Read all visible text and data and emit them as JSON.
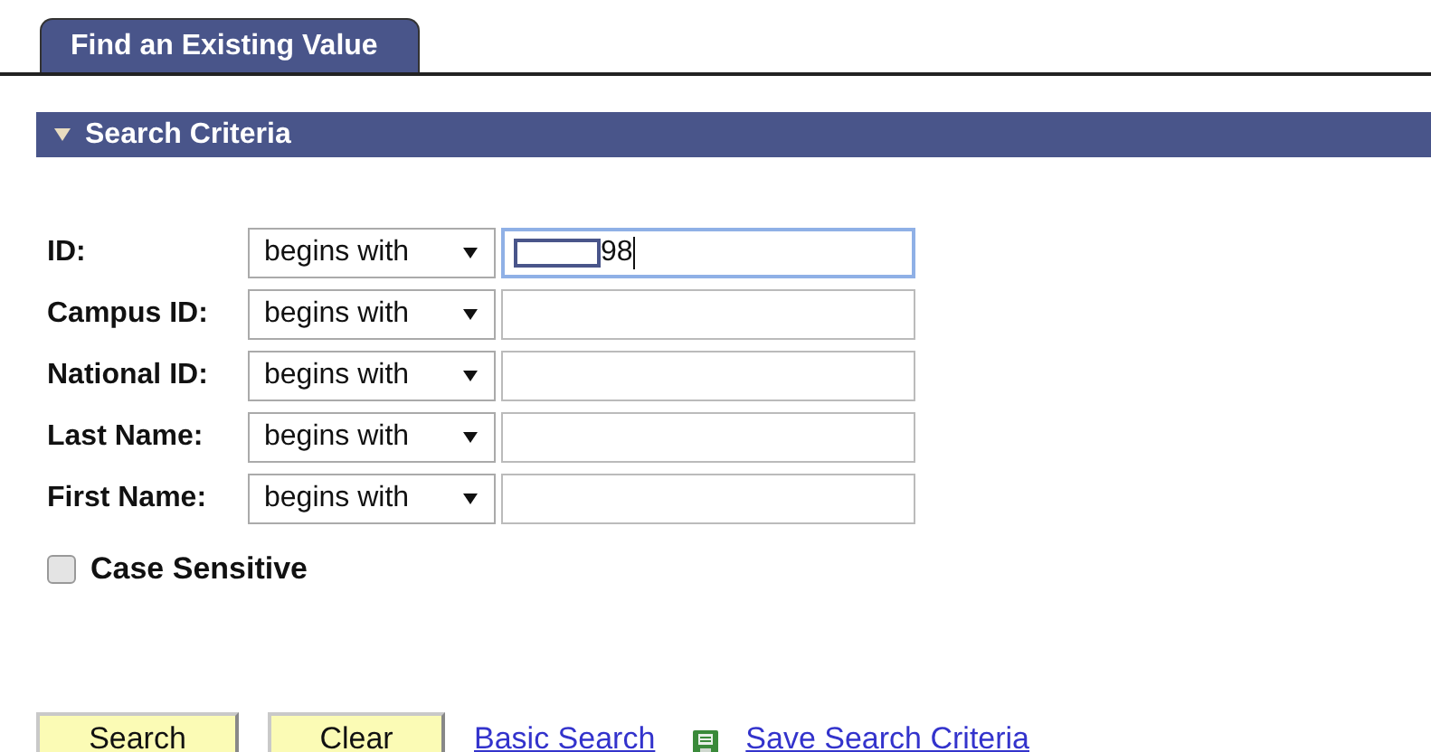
{
  "tabs": [
    {
      "label": "Find an Existing Value",
      "selected": true
    }
  ],
  "section": {
    "title": "Search Criteria",
    "expanded": true
  },
  "fields": [
    {
      "label": "ID:",
      "operator": "begins with",
      "value": "98",
      "redacted_prefix": true,
      "focused": true
    },
    {
      "label": "Campus ID:",
      "operator": "begins with",
      "redacted_prefix": false,
      "focused": false
    },
    {
      "label": "National ID:",
      "operator": "begins with",
      "redacted_prefix": false,
      "focused": false
    },
    {
      "label": "Last Name:",
      "operator": "begins with",
      "redacted_prefix": false,
      "focused": false
    },
    {
      "label": "First Name:",
      "operator": "begins with",
      "redacted_prefix": false,
      "focused": false
    }
  ],
  "case_sensitive": {
    "label": "Case Sensitive",
    "checked": false
  },
  "buttons": [
    "Search",
    "Clear"
  ],
  "links": [
    {
      "label": "Basic Search",
      "icon": false
    },
    {
      "label": "Save Search Criteria",
      "icon": true
    }
  ]
}
